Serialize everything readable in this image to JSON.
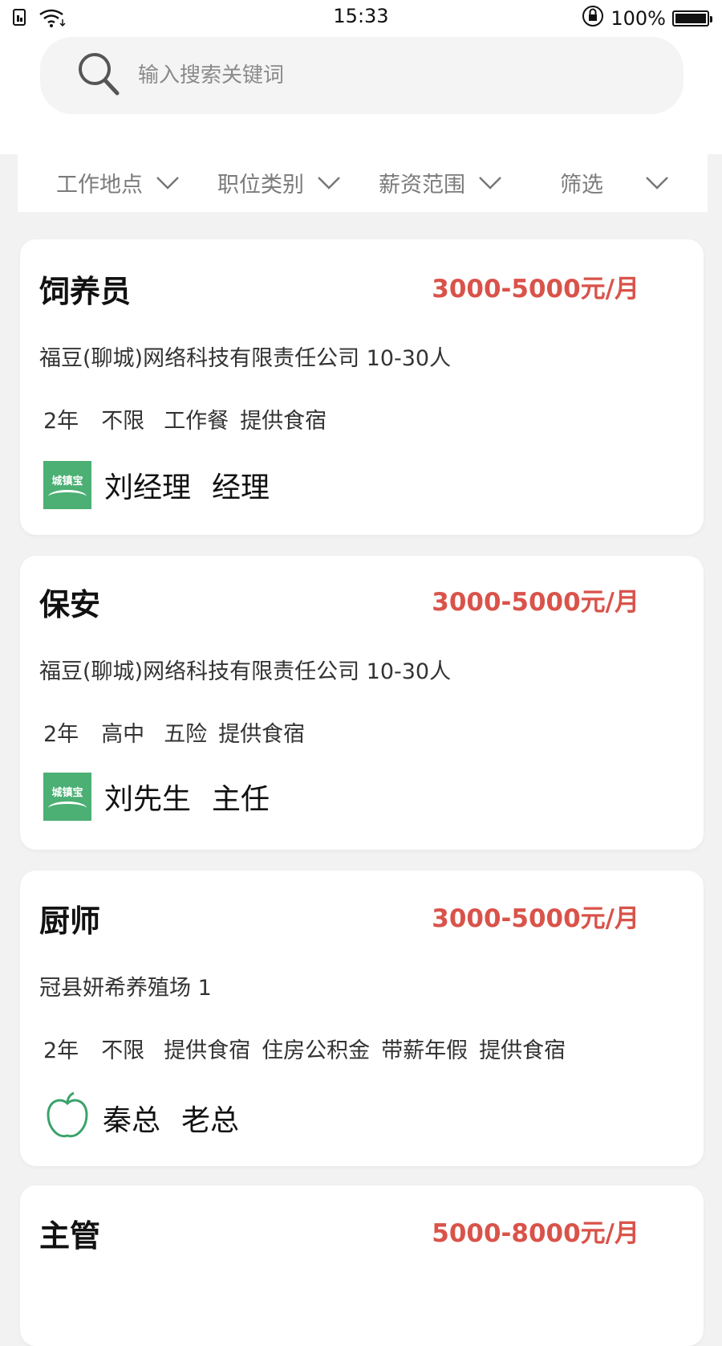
{
  "status_bar": {
    "time": "15:33",
    "battery": "100%",
    "icons": [
      "sim-icon",
      "wifi-icon",
      "lock-rotation-icon",
      "battery-icon"
    ]
  },
  "search": {
    "placeholder": "输入搜索关键词",
    "value": ""
  },
  "filters": [
    {
      "label": "工作地点"
    },
    {
      "label": "职位类别"
    },
    {
      "label": "薪资范围"
    },
    {
      "label": "筛选"
    }
  ],
  "jobs": [
    {
      "title": "饲养员",
      "salary": "3000-5000元/月",
      "company": "福豆(聊城)网络科技有限责任公司 10-30人",
      "tags": [
        "2年",
        "不限",
        "工作餐",
        "提供食宿"
      ],
      "logo": "城镇宝",
      "contact_name": "刘经理",
      "contact_role": "经理"
    },
    {
      "title": "保安",
      "salary": "3000-5000元/月",
      "company": "福豆(聊城)网络科技有限责任公司 10-30人",
      "tags": [
        "2年",
        "高中",
        "五险",
        "提供食宿"
      ],
      "logo": "城镇宝",
      "contact_name": "刘先生",
      "contact_role": "主任"
    },
    {
      "title": "厨师",
      "salary": "3000-5000元/月",
      "company": "冠县妍希养殖场 1",
      "tags": [
        "2年",
        "不限",
        "提供食宿",
        "住房公积金",
        "带薪年假",
        "提供食宿"
      ],
      "logo": "apple-icon",
      "contact_name": "秦总",
      "contact_role": "老总"
    },
    {
      "title": "主管",
      "salary": "5000-8000元/月"
    }
  ],
  "colors": {
    "salary": "#d9534a",
    "logo_green": "#4caf74",
    "background": "#f2f2f2"
  }
}
